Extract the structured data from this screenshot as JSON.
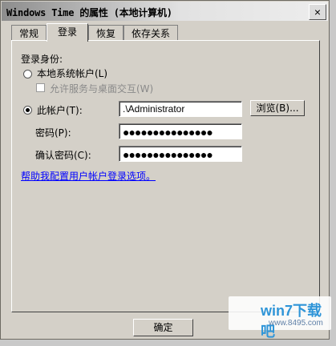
{
  "window": {
    "title": "Windows Time 的属性 (本地计算机)",
    "close_label": "×"
  },
  "tabs": [
    {
      "label": "常规"
    },
    {
      "label": "登录"
    },
    {
      "label": "恢复"
    },
    {
      "label": "依存关系"
    }
  ],
  "logon": {
    "section_label": "登录身份:",
    "local_system_label": "本地系统帐户(L)",
    "desktop_interaction_label": "允许服务与桌面交互(W)",
    "this_account_label": "此帐户(T):",
    "account_value": ".\\Administrator",
    "browse_label": "浏览(B)...",
    "password_label": "密码(P):",
    "password_value": "●●●●●●●●●●●●●●●",
    "confirm_label": "确认密码(C):",
    "confirm_value": "●●●●●●●●●●●●●●●",
    "help_link": "帮助我配置用户帐户登录选项。"
  },
  "footer": {
    "ok_label": "确定"
  },
  "watermark": {
    "title": "win7下载吧",
    "url": "www.8495.com"
  },
  "colors": {
    "window_bg": "#d4d0c8",
    "link": "#0000ff",
    "watermark_blue": "#2f95d8"
  }
}
